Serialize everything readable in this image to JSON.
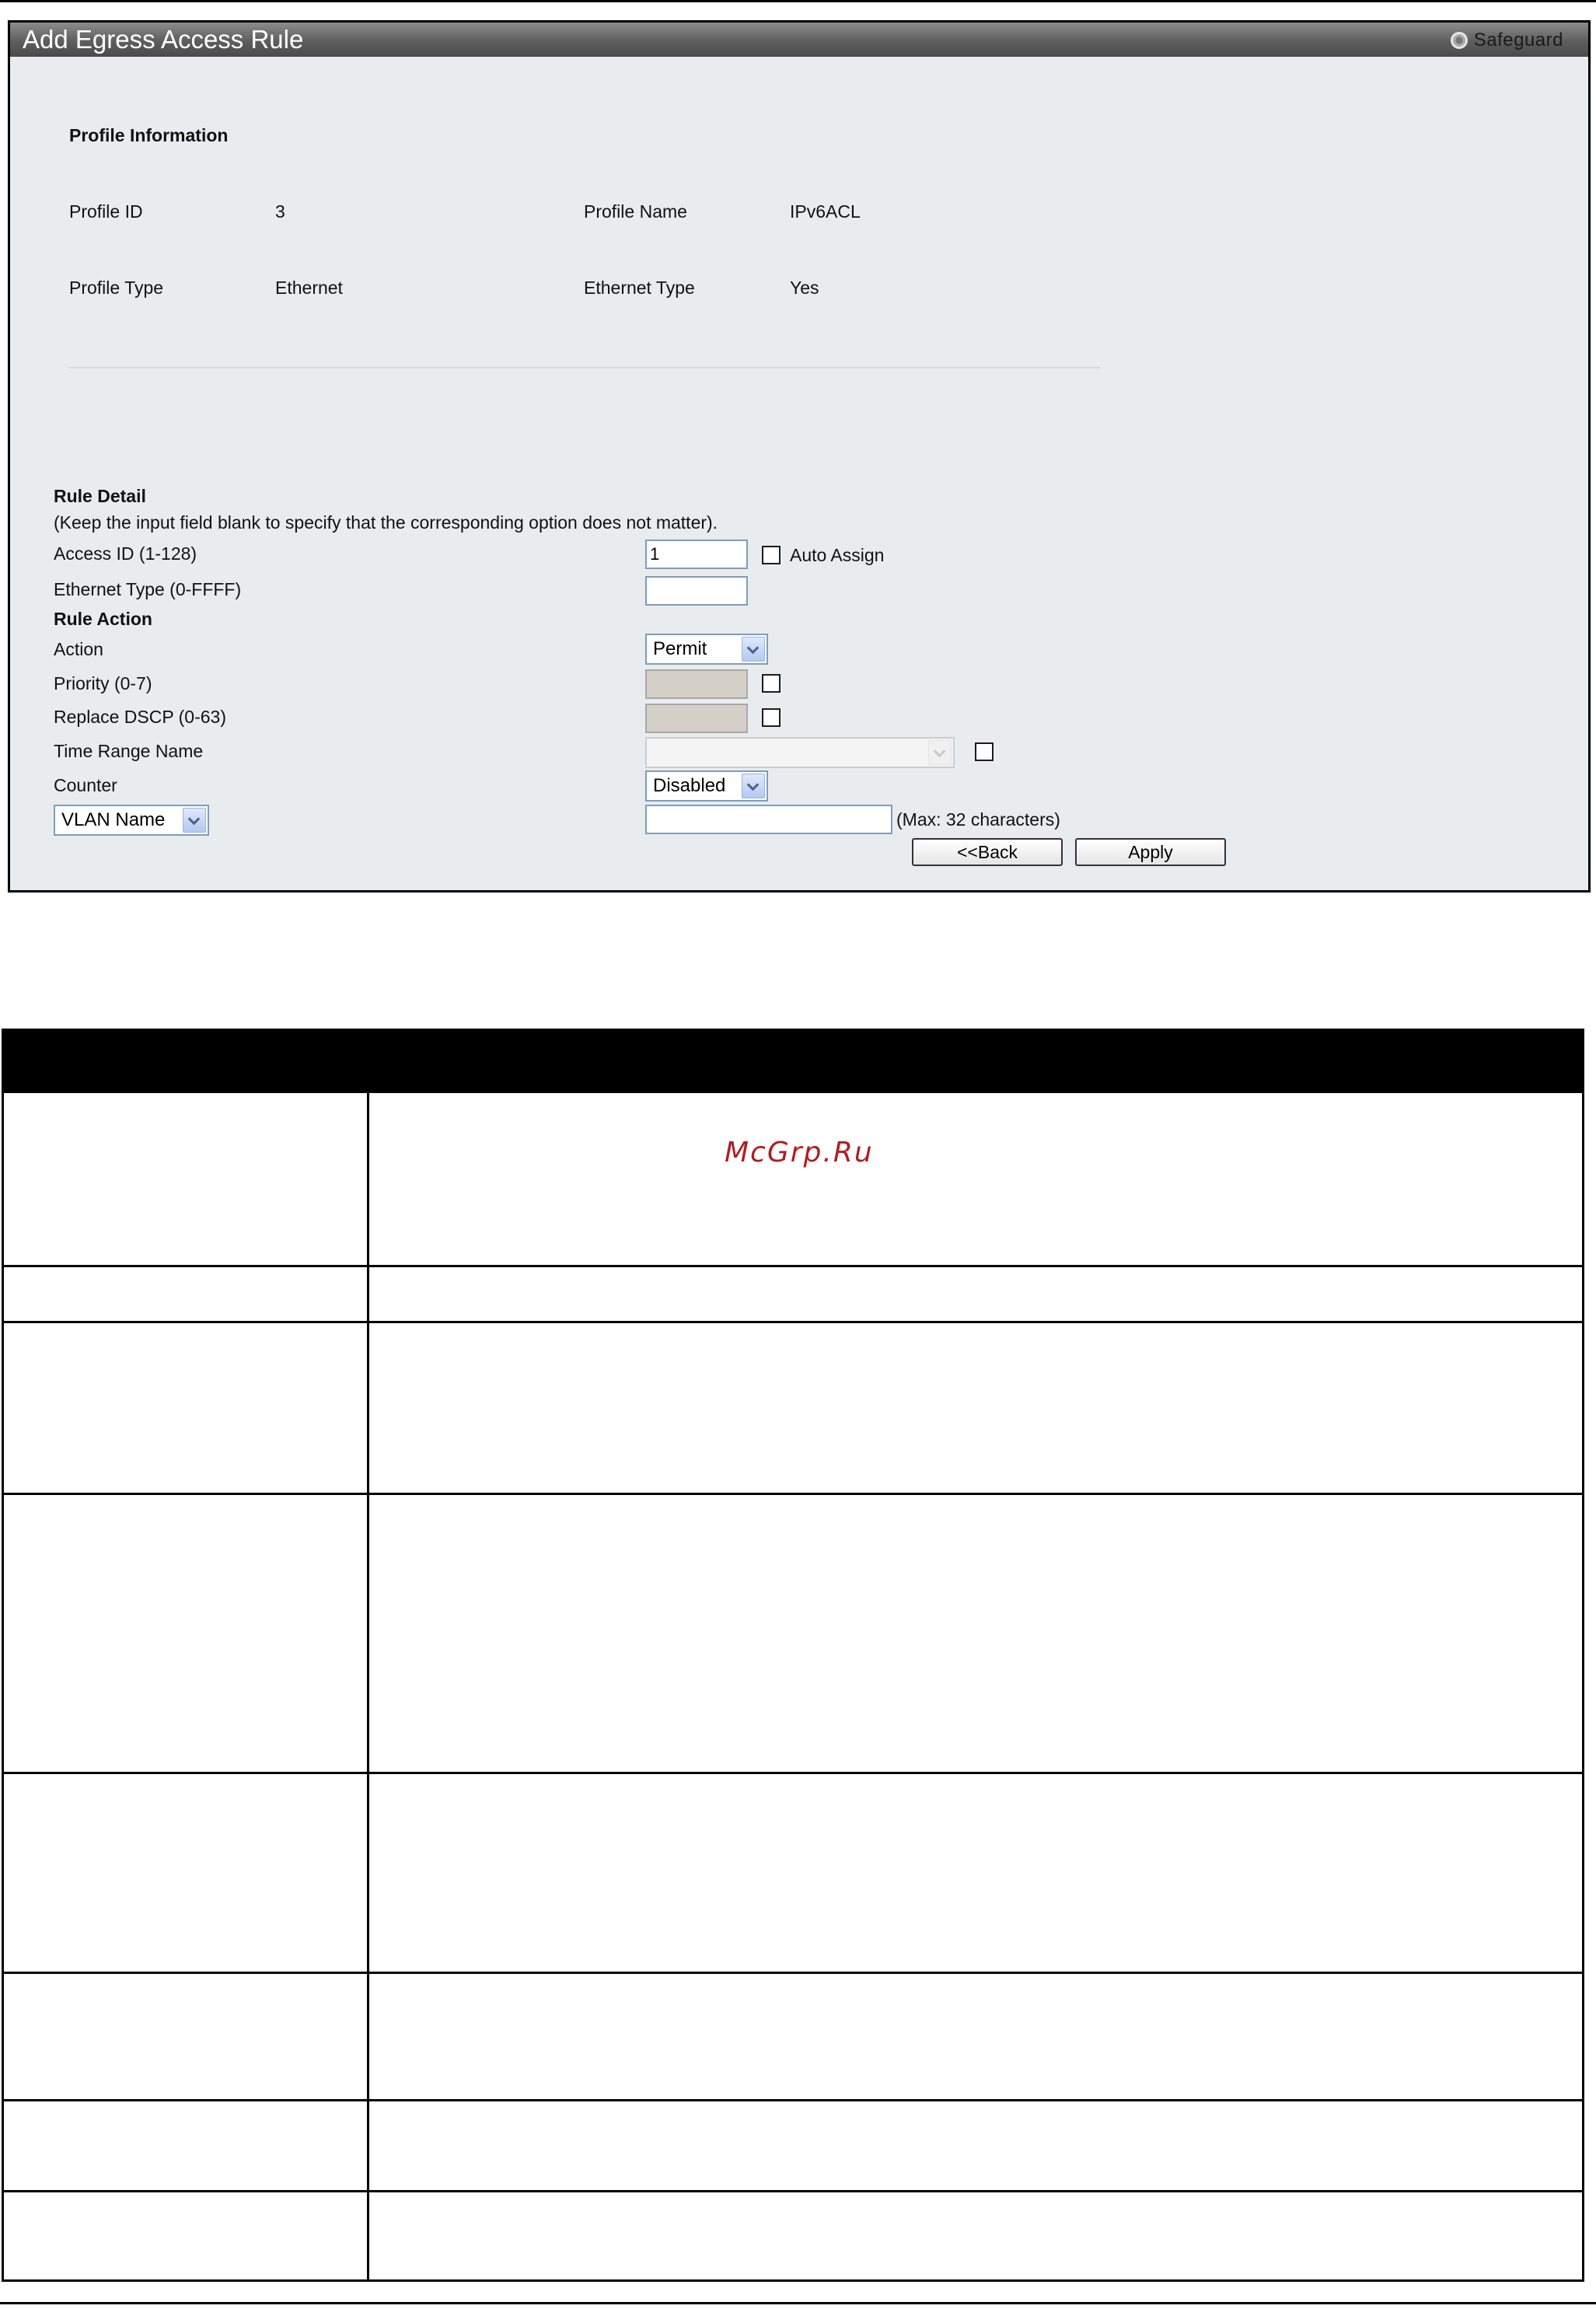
{
  "window": {
    "title": "Add Egress Access Rule",
    "safeguard_label": "Safeguard"
  },
  "profile_info": {
    "heading": "Profile Information",
    "profile_id_label": "Profile ID",
    "profile_id_value": "3",
    "profile_name_label": "Profile Name",
    "profile_name_value": "IPv6ACL",
    "profile_type_label": "Profile Type",
    "profile_type_value": "Ethernet",
    "ethernet_type_label": "Ethernet Type",
    "ethernet_type_value": "Yes"
  },
  "rule_detail": {
    "heading": "Rule Detail",
    "note": "(Keep the input field blank to specify that the corresponding option does not matter).",
    "access_id_label": "Access ID (1-128)",
    "access_id_value": "1",
    "auto_assign_label": "Auto Assign",
    "ethernet_type_label": "Ethernet Type  (0-FFFF)",
    "ethernet_type_value": ""
  },
  "rule_action": {
    "heading": "Rule Action",
    "action_label": "Action",
    "action_value": "Permit",
    "priority_label": "Priority  (0-7)",
    "replace_dscp_label": "Replace DSCP  (0-63)",
    "time_range_label": "Time Range Name",
    "time_range_value": "",
    "counter_label": "Counter",
    "counter_value": "Disabled",
    "vlan_select_value": "VLAN Name",
    "vlan_input_value": "",
    "vlan_hint": "(Max: 32 characters)"
  },
  "buttons": {
    "back": "<<Back",
    "apply": "Apply"
  },
  "watermark": "McGrp.Ru",
  "colors": {
    "panel_background": "#e8ecee",
    "titlebar": "#5e5e5e",
    "input_border": "#7f9db9",
    "watermark": "#b01e22"
  }
}
